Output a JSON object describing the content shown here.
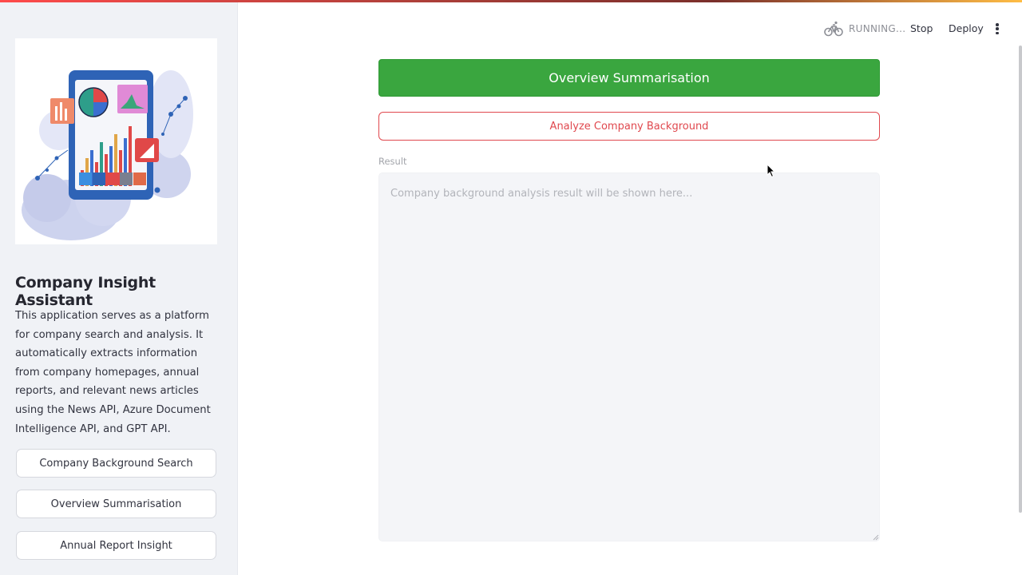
{
  "header": {
    "status_text": "RUNNING...",
    "stop_label": "Stop",
    "deploy_label": "Deploy",
    "status_icon": "running-bicycle-icon",
    "menu_icon": "kebab-menu-icon"
  },
  "sidebar": {
    "image_icon": "analytics-dashboard-illustration",
    "title": "Company Insight Assistant",
    "description": "This application serves as a platform for company search and analysis. It automatically extracts information from company homepages, annual reports, and relevant news articles using the News API, Azure Document Intelligence API, and GPT API.",
    "buttons": [
      {
        "label": "Company Background Search"
      },
      {
        "label": "Overview Summarisation"
      },
      {
        "label": "Annual Report Insight"
      }
    ]
  },
  "main": {
    "primary_button_label": "Overview Summarisation",
    "secondary_button_label": "Analyze Company Background",
    "result_label": "Result",
    "result_placeholder": "Company background analysis result will be shown here..."
  },
  "colors": {
    "primary_green": "#3aa63f",
    "accent_red": "#e0484e",
    "sidebar_bg": "#f0f2f6"
  }
}
